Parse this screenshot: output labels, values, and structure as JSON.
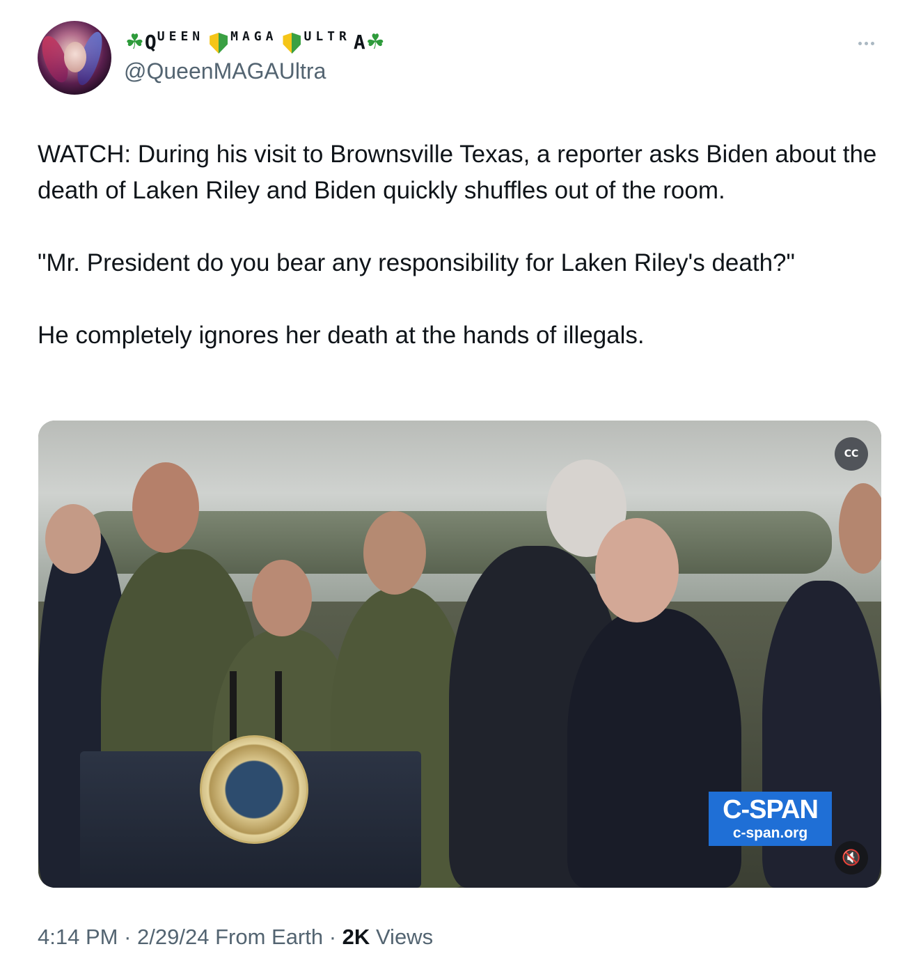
{
  "author": {
    "display_name_parts": [
      "Q",
      "UEEN",
      "MAGA",
      "ULTR",
      "A"
    ],
    "handle": "@QueenMAGAUltra",
    "avatar_icon": "avatar-portrait-icon"
  },
  "more_menu": {
    "icon": "more-horizontal-icon"
  },
  "tweet": {
    "paragraphs": [
      "WATCH: During his visit to Brownsville Texas, a reporter asks Biden about the death of Laken Riley and Biden quickly shuffles out of the room.",
      "\"Mr. President do you bear any responsibility for Laken Riley's death?\"",
      "He completely ignores her death at the hands of illegals."
    ]
  },
  "media": {
    "type": "video",
    "watermark": {
      "logo": "C-SPAN",
      "url": "c-span.org"
    },
    "captions_button_icon": "closed-captions-off-icon",
    "mute_button_icon": "volume-muted-icon"
  },
  "meta": {
    "time": "4:14 PM",
    "date": "2/29/24",
    "source": "From Earth",
    "views_count": "2K",
    "views_label": "Views"
  },
  "colors": {
    "text": "#0f1419",
    "secondary": "#536471",
    "cspan_blue": "#1f6fd6"
  }
}
